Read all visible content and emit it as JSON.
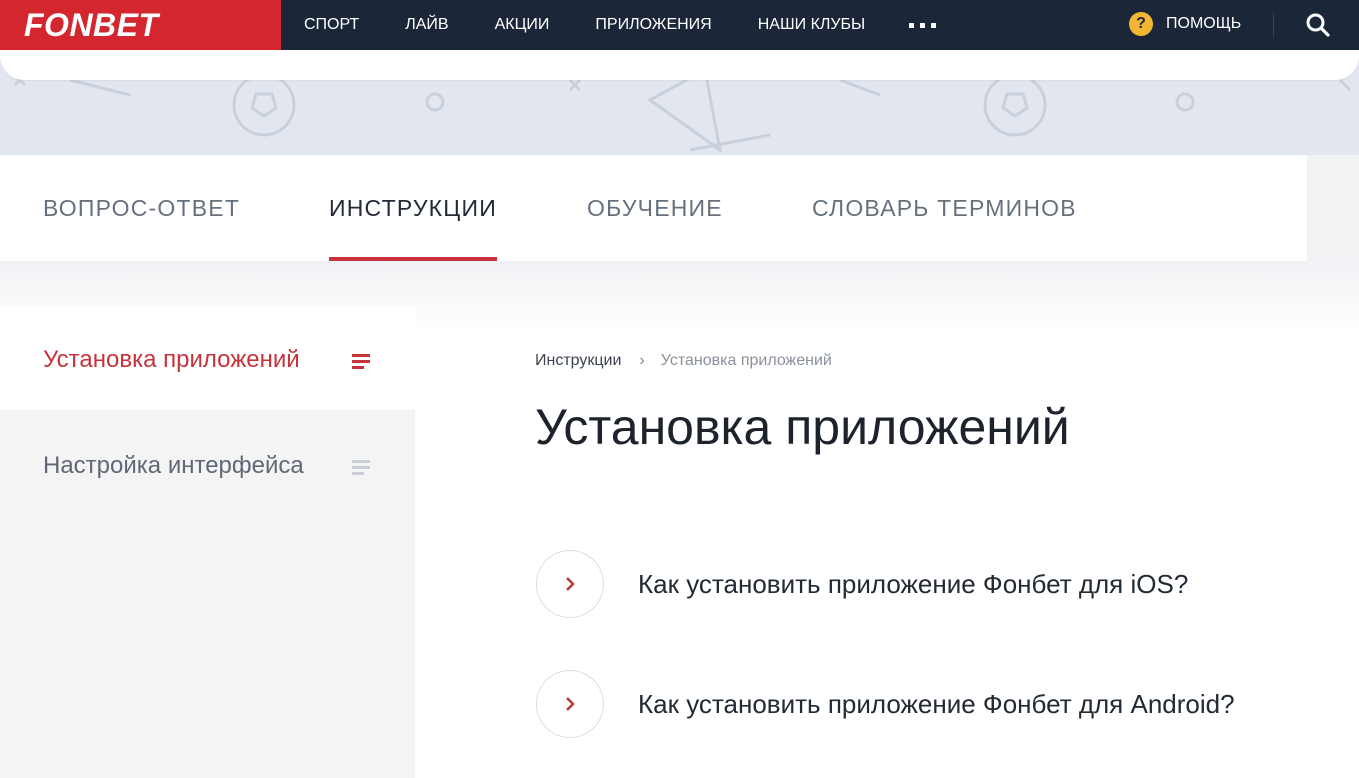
{
  "header": {
    "logo": "FONBET",
    "nav": [
      "СПОРТ",
      "ЛАЙВ",
      "АКЦИИ",
      "ПРИЛОЖЕНИЯ",
      "НАШИ КЛУБЫ"
    ],
    "help_label": "ПОМОЩЬ",
    "help_icon_glyph": "?"
  },
  "tabs": [
    "ВОПРОС-ОТВЕТ",
    "ИНСТРУКЦИИ",
    "ОБУЧЕНИЕ",
    "СЛОВАРЬ ТЕРМИНОВ"
  ],
  "sidebar": {
    "items": [
      {
        "label": "Установка приложений"
      },
      {
        "label": "Настройка интерфейса"
      }
    ]
  },
  "breadcrumb": {
    "parent": "Инструкции",
    "current": "Установка приложений"
  },
  "main": {
    "title": "Установка приложений",
    "articles": [
      {
        "label": "Как установить приложение Фонбет для iOS?"
      },
      {
        "label": "Как установить приложение Фонбет для Android?"
      }
    ]
  },
  "colors": {
    "brand_red": "#d3262e",
    "header_bg": "#1b2639",
    "accent": "#c7333b",
    "help_yellow": "#f2b632"
  }
}
